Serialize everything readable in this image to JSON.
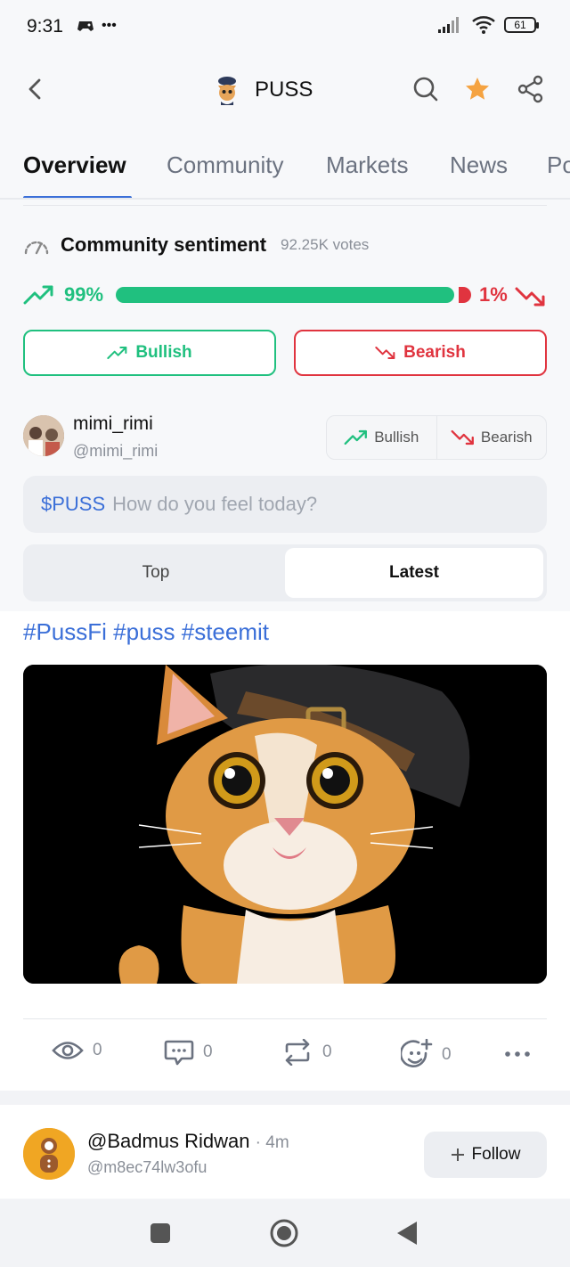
{
  "status_bar": {
    "time": "9:31",
    "extra": "•••",
    "battery": "61"
  },
  "header": {
    "coin_name": "PUSS"
  },
  "tabs": [
    {
      "label": "Overview"
    },
    {
      "label": "Community"
    },
    {
      "label": "Markets"
    },
    {
      "label": "News"
    },
    {
      "label": "Po"
    }
  ],
  "sentiment": {
    "title": "Community sentiment",
    "votes": "92.25K votes",
    "bullish_pct": "99%",
    "bearish_pct": "1%",
    "bullish_fraction": 0.99,
    "bullish_label": "Bullish",
    "bearish_label": "Bearish"
  },
  "composer": {
    "user_name": "mimi_rimi",
    "user_handle": "@mimi_rimi",
    "bullish_label": "Bullish",
    "bearish_label": "Bearish",
    "ticker": "$PUSS",
    "placeholder": "How do you feel today?"
  },
  "feed_toggle": {
    "top_label": "Top",
    "latest_label": "Latest",
    "selected": "Latest"
  },
  "post": {
    "hashtags": "#PussFi #puss #steemit",
    "views": "0",
    "comments": "0",
    "reposts": "0",
    "reactions": "0"
  },
  "next_post": {
    "author": "@Badmus Ridwan",
    "time": "· 4m",
    "handle": "@m8ec74lw3ofu",
    "follow_label": "Follow"
  },
  "colors": {
    "bullish": "#20c07f",
    "bearish": "#e0343f",
    "accent": "#3b6fd8",
    "star": "#f5a341"
  }
}
